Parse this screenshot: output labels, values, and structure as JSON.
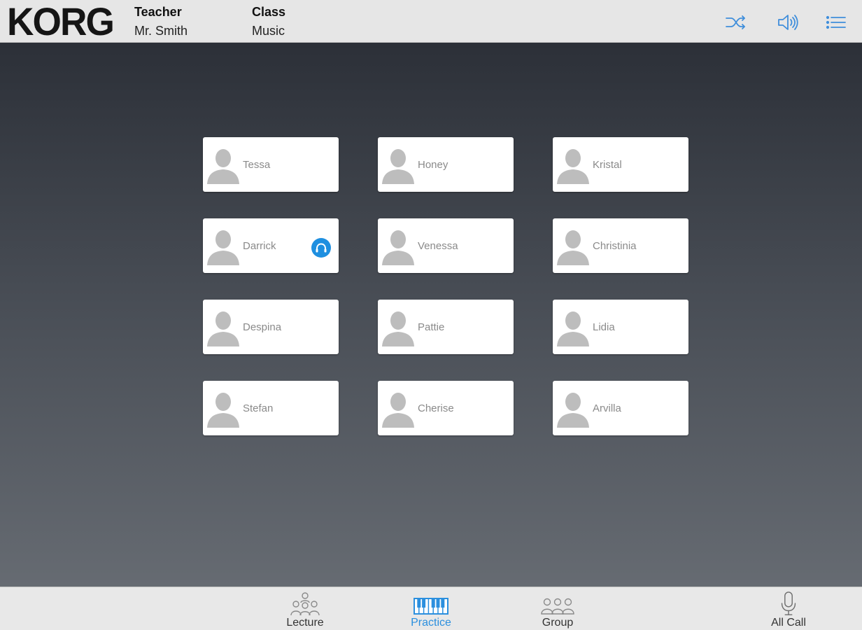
{
  "header": {
    "logo": "KORG",
    "teacher_label": "Teacher",
    "teacher_name": "Mr. Smith",
    "class_label": "Class",
    "class_name": "Music",
    "icons": [
      "shuffle-icon",
      "speaker-icon",
      "list-menu-icon"
    ]
  },
  "students": [
    {
      "name": "Tessa",
      "calling": false
    },
    {
      "name": "Honey",
      "calling": false
    },
    {
      "name": "Kristal",
      "calling": false
    },
    {
      "name": "Darrick",
      "calling": true
    },
    {
      "name": "Venessa",
      "calling": false
    },
    {
      "name": "Christinia",
      "calling": false
    },
    {
      "name": "Despina",
      "calling": false
    },
    {
      "name": "Pattie",
      "calling": false
    },
    {
      "name": "Lidia",
      "calling": false
    },
    {
      "name": "Stefan",
      "calling": false
    },
    {
      "name": "Cherise",
      "calling": false
    },
    {
      "name": "Arvilla",
      "calling": false
    }
  ],
  "footer": {
    "tabs": [
      {
        "label": "Lecture",
        "icon": "lecture-icon",
        "selected": false
      },
      {
        "label": "Practice",
        "icon": "piano-keys-icon",
        "selected": true
      },
      {
        "label": "Group",
        "icon": "group-icon",
        "selected": false
      },
      {
        "label": "All Call",
        "icon": "microphone-icon",
        "selected": false
      }
    ]
  },
  "colors": {
    "accent": "#2b8fde",
    "badge": "#1e8fe0",
    "avatar": "#bdbdbd",
    "header_bg": "#e6e6e6"
  }
}
